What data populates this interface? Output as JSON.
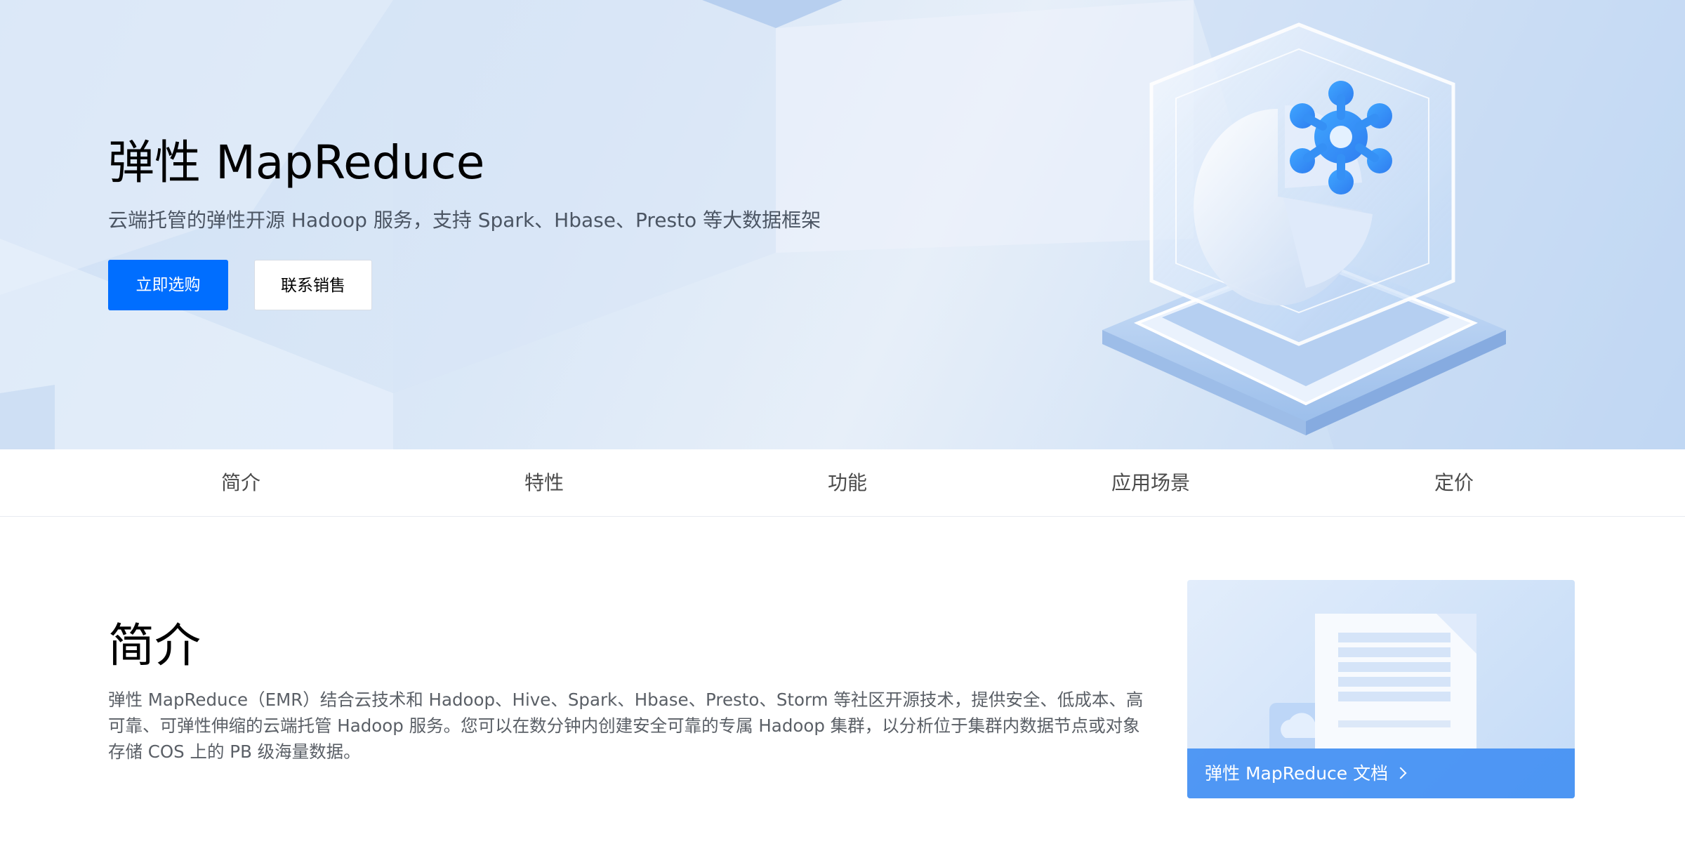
{
  "hero": {
    "title": "弹性 MapReduce",
    "subtitle": "云端托管的弹性开源 Hadoop 服务，支持 Spark、Hbase、Presto 等大数据框架",
    "primary_button": "立即选购",
    "secondary_button": "联系销售",
    "illustration": "cube-pie-chart-gear-icon"
  },
  "tabs": [
    {
      "label": "简介"
    },
    {
      "label": "特性"
    },
    {
      "label": "功能"
    },
    {
      "label": "应用场景"
    },
    {
      "label": "定价"
    }
  ],
  "intro": {
    "title": "简介",
    "body": "弹性 MapReduce（EMR）结合云技术和 Hadoop、Hive、Spark、Hbase、Presto、Storm 等社区开源技术，提供安全、低成本、高可靠、可弹性伸缩的云端托管 Hadoop 服务。您可以在数分钟内创建安全可靠的专属 Hadoop 集群，以分析位于集群内数据节点或对象存储 COS 上的 PB 级海量数据。"
  },
  "doc_card": {
    "label": "弹性 MapReduce 文档",
    "icon": "chevron-right-icon",
    "art": "document-cloud-icon"
  },
  "colors": {
    "primary": "#006eff",
    "doc_footer": "#3c8cf2",
    "hero_bg": "#d8e6f7"
  }
}
